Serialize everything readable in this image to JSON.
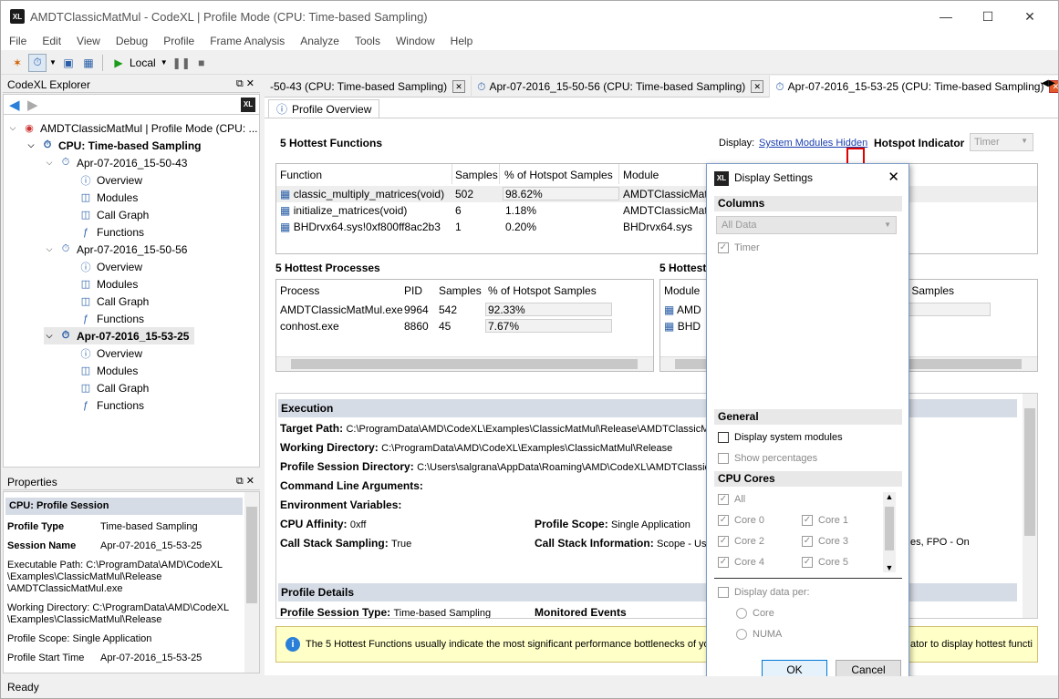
{
  "window": {
    "title": "AMDTClassicMatMul - CodeXL | Profile Mode (CPU: Time-based Sampling)",
    "logo": "XL"
  },
  "menu": [
    "File",
    "Edit",
    "View",
    "Debug",
    "Profile",
    "Frame Analysis",
    "Analyze",
    "Tools",
    "Window",
    "Help"
  ],
  "toolbar": {
    "local_label": "Local"
  },
  "explorer": {
    "title": "CodeXL Explorer",
    "root": "AMDTClassicMatMul | Profile Mode (CPU: ...",
    "cpu": "CPU: Time-based Sampling",
    "sessions": [
      "Apr-07-2016_15-50-43",
      "Apr-07-2016_15-50-56",
      "Apr-07-2016_15-53-25"
    ],
    "children": [
      "Overview",
      "Modules",
      "Call Graph",
      "Functions"
    ]
  },
  "properties": {
    "title": "Properties",
    "header": "CPU: Profile Session",
    "profile_type_label": "Profile Type",
    "profile_type": "Time-based Sampling",
    "session_name_label": "Session Name",
    "session_name": "Apr-07-2016_15-53-25",
    "exe_1": "Executable Path: C:\\ProgramData\\AMD\\CodeXL",
    "exe_2": "\\Examples\\ClassicMatMul\\Release",
    "exe_3": "\\AMDTClassicMatMul.exe",
    "wd_1": "Working Directory: C:\\ProgramData\\AMD\\CodeXL",
    "wd_2": "\\Examples\\ClassicMatMul\\Release",
    "scope": "Profile Scope: Single Application",
    "start_label": "Profile Start Time",
    "start": "Apr-07-2016_15-53-25"
  },
  "tabs": [
    "-50-43 (CPU: Time-based Sampling)",
    "Apr-07-2016_15-50-56 (CPU: Time-based Sampling)",
    "Apr-07-2016_15-53-25 (CPU: Time-based Sampling)"
  ],
  "subtab": "Profile Overview",
  "overview": {
    "hot_functions_title": "5 Hottest Functions",
    "display_label": "Display:",
    "display_link": "System Modules Hidden",
    "hotspot_label": "Hotspot Indicator",
    "hotspot_value": "Timer",
    "func_cols": [
      "Function",
      "Samples",
      "% of Hotspot Samples",
      "Module"
    ],
    "functions": [
      {
        "name": "classic_multiply_matrices(void)",
        "samples": "502",
        "pct": "98.62%",
        "pct_val": 98.62,
        "module": "AMDTClassicMat"
      },
      {
        "name": "initialize_matrices(void)",
        "samples": "6",
        "pct": "1.18%",
        "pct_val": 1.18,
        "module": "AMDTClassicMat"
      },
      {
        "name": "BHDrvx64.sys!0xf800ff8ac2b3",
        "samples": "1",
        "pct": "0.20%",
        "pct_val": 0.2,
        "module": "BHDrvx64.sys"
      }
    ],
    "hot_proc_title": "5 Hottest Processes",
    "proc_cols": [
      "Process",
      "PID",
      "Samples",
      "% of Hotspot Samples"
    ],
    "processes": [
      {
        "name": "AMDTClassicMatMul.exe",
        "pid": "9964",
        "samples": "542",
        "pct": "92.33%",
        "pct_val": 92.33
      },
      {
        "name": "conhost.exe",
        "pid": "8860",
        "samples": "45",
        "pct": "7.67%",
        "pct_val": 7.67
      }
    ],
    "hot_mod_title": "5 Hottest",
    "mod_col": "Module",
    "mod_col2": "ot Samples",
    "modules": [
      "AMD",
      "BHD"
    ]
  },
  "execution": {
    "title": "Execution",
    "target_label": "Target Path:",
    "target": "C:\\ProgramData\\AMD\\CodeXL\\Examples\\ClassicMatMul\\Release\\AMDTClassicMat",
    "wd_label": "Working Directory:",
    "wd": "C:\\ProgramData\\AMD\\CodeXL\\Examples\\ClassicMatMul\\Release",
    "psd_label": "Profile Session Directory:",
    "psd": "C:\\Users\\salgrana\\AppData\\Roaming\\AMD\\CodeXL\\AMDTClassicMa",
    "cla_label": "Command Line Arguments:",
    "env_label": "Environment Variables:",
    "aff_label": "CPU Affinity:",
    "aff": "0xff",
    "scope_label": "Profile Scope:",
    "scope": "Single Application",
    "css_label": "Call Stack Sampling:",
    "css": "True",
    "csi_label": "Call Stack Information:",
    "csi": "Scope - Use",
    "csi_tail": "es, FPO - On",
    "details_title": "Profile Details",
    "pst_label": "Profile Session Type:",
    "pst": "Time-based Sampling",
    "mon_label": "Monitored Events"
  },
  "info_bar": {
    "text": "The 5 Hottest Functions usually indicate the most significant performance bottlenecks of you",
    "tail": "ator to display hottest functi"
  },
  "dialog": {
    "title": "Display Settings",
    "columns": "Columns",
    "combo": "All Data",
    "timer": "Timer",
    "general": "General",
    "sys_modules": "Display system modules",
    "show_pct": "Show percentages",
    "cores_title": "CPU Cores",
    "all": "All",
    "cores": [
      "Core 0",
      "Core 1",
      "Core 2",
      "Core 3",
      "Core 4",
      "Core 5"
    ],
    "per": "Display data per:",
    "core_opt": "Core",
    "numa_opt": "NUMA",
    "ok": "OK",
    "cancel": "Cancel"
  },
  "status": "Ready",
  "colors": {
    "accent": "#2a5fa8",
    "info_bg": "#ffffc8",
    "arrow": "#e00000",
    "section": "#d6dce6"
  }
}
